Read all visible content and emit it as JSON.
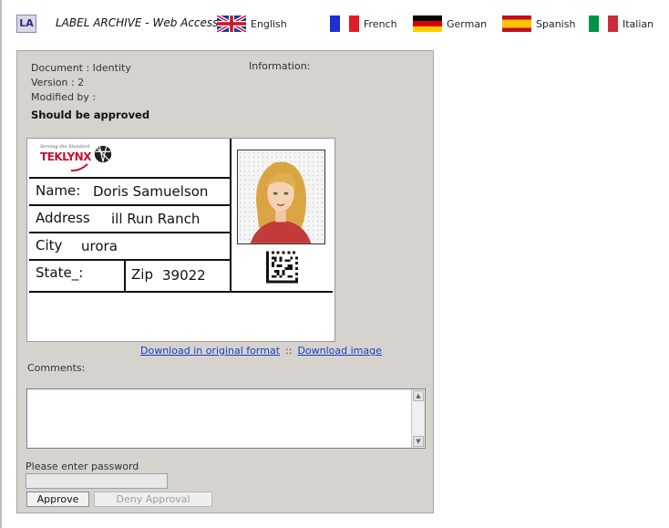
{
  "header": {
    "logo_text": "LA",
    "title": "LABEL ARCHIVE - Web Access",
    "languages": [
      {
        "label": "English",
        "flag": "uk-flag"
      },
      {
        "label": "French",
        "flag": "france-flag"
      },
      {
        "label": "German",
        "flag": "germany-flag"
      },
      {
        "label": "Spanish",
        "flag": "spain-flag"
      },
      {
        "label": "Italian",
        "flag": "italy-flag"
      }
    ]
  },
  "document": {
    "document_line": "Document  : Identity",
    "version_line": "Version     : 2",
    "modified_line": "Modified by :",
    "information_label": "Information:",
    "status": "Should be approved"
  },
  "label": {
    "logo_tagline": "Serving the Standard",
    "logo_text": "TEKLYNX",
    "name_label": "Name:",
    "name_value": "Doris Samuelson",
    "address_label": "Address",
    "address_value": "ill Run Ranch",
    "city_label": "City",
    "city_value": "urora",
    "state_label": "State_:",
    "zip_label": "Zip",
    "zip_value": "39022"
  },
  "links": {
    "download_original": "Download in original format",
    "separator": "::",
    "download_image": "Download image"
  },
  "form": {
    "comments_label": "Comments:",
    "comments_value": "",
    "password_label": "Please enter password",
    "password_value": "",
    "approve_label": "Approve",
    "deny_label": "Deny Approval"
  },
  "colors": {
    "panel_background": "#d6d3ce",
    "link": "#1a3fbf",
    "logo_red": "#c8102e"
  }
}
